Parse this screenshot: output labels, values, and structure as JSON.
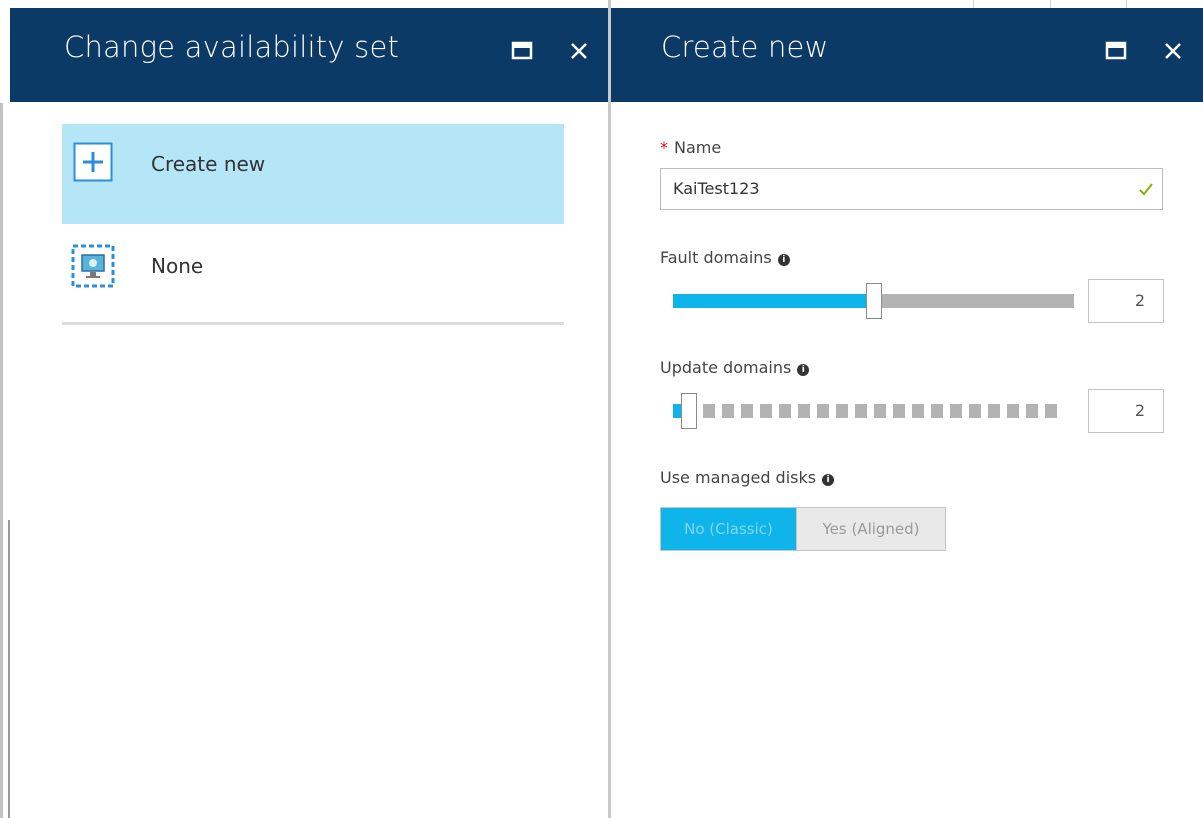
{
  "left_blade": {
    "title": "Change availability set",
    "items": [
      {
        "label": "Create new",
        "icon": "plus-icon",
        "selected": true
      },
      {
        "label": "None",
        "icon": "availability-set-icon",
        "selected": false
      }
    ]
  },
  "right_blade": {
    "title": "Create new",
    "name_field": {
      "required_mark": "*",
      "label": "Name",
      "value": "KaiTest123",
      "valid": true
    },
    "fault_domains": {
      "label": "Fault domains",
      "info": "i",
      "value": "2",
      "min": 1,
      "max": 3
    },
    "update_domains": {
      "label": "Update domains",
      "info": "i",
      "value": "2",
      "min": 1,
      "max": 20
    },
    "managed_disks": {
      "label": "Use managed disks",
      "info": "i",
      "options": [
        "No (Classic)",
        "Yes (Aligned)"
      ],
      "selected": "No (Classic)"
    }
  },
  "colors": {
    "header": "#0b3a66",
    "accent": "#0fb4ea",
    "selected_row": "#b4e6f8",
    "track": "#b3b3b3",
    "required": "#d0161a",
    "valid_check": "#7ab800"
  }
}
